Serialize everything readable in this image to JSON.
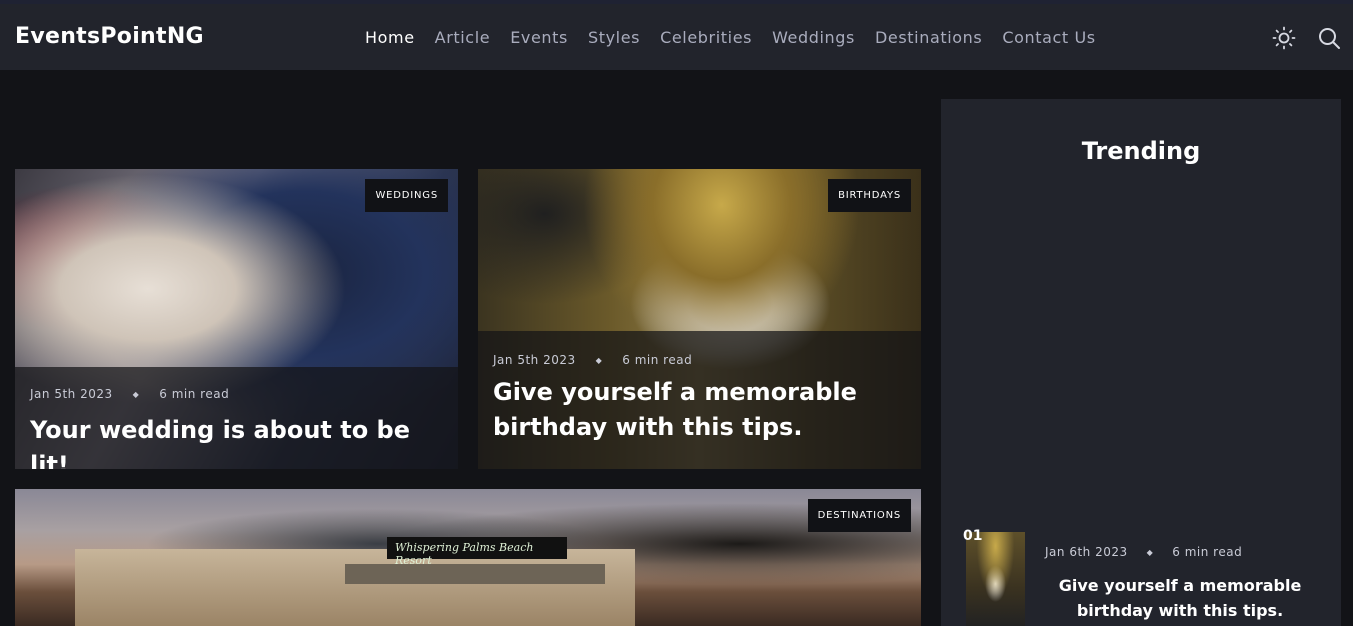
{
  "brand": "EventsPointNG",
  "nav": [
    "Home",
    "Article",
    "Events",
    "Styles",
    "Celebrities",
    "Weddings",
    "Destinations",
    "Contact Us"
  ],
  "icons": {
    "theme": "sun-icon",
    "search": "search-icon"
  },
  "cards": [
    {
      "badge": "WEDDINGS",
      "date": "Jan 5th 2023",
      "read": "6 min read",
      "title": "Your wedding is about to be lit!"
    },
    {
      "badge": "BIRTHDAYS",
      "date": "Jan 5th 2023",
      "read": "6 min read",
      "title": "Give yourself a memorable birthday with this tips."
    },
    {
      "badge": "DESTINATIONS",
      "sign": "Whispering Palms Beach Resort"
    }
  ],
  "sidebar": {
    "title": "Trending",
    "item": {
      "num": "01",
      "date": "Jan 6th 2023",
      "read": "6 min read",
      "title": "Give yourself a memorable birthday with this tips."
    }
  },
  "colors": {
    "header_bg": "#22242c",
    "page_bg": "#121317",
    "nav_inactive": "#a9acbd"
  }
}
